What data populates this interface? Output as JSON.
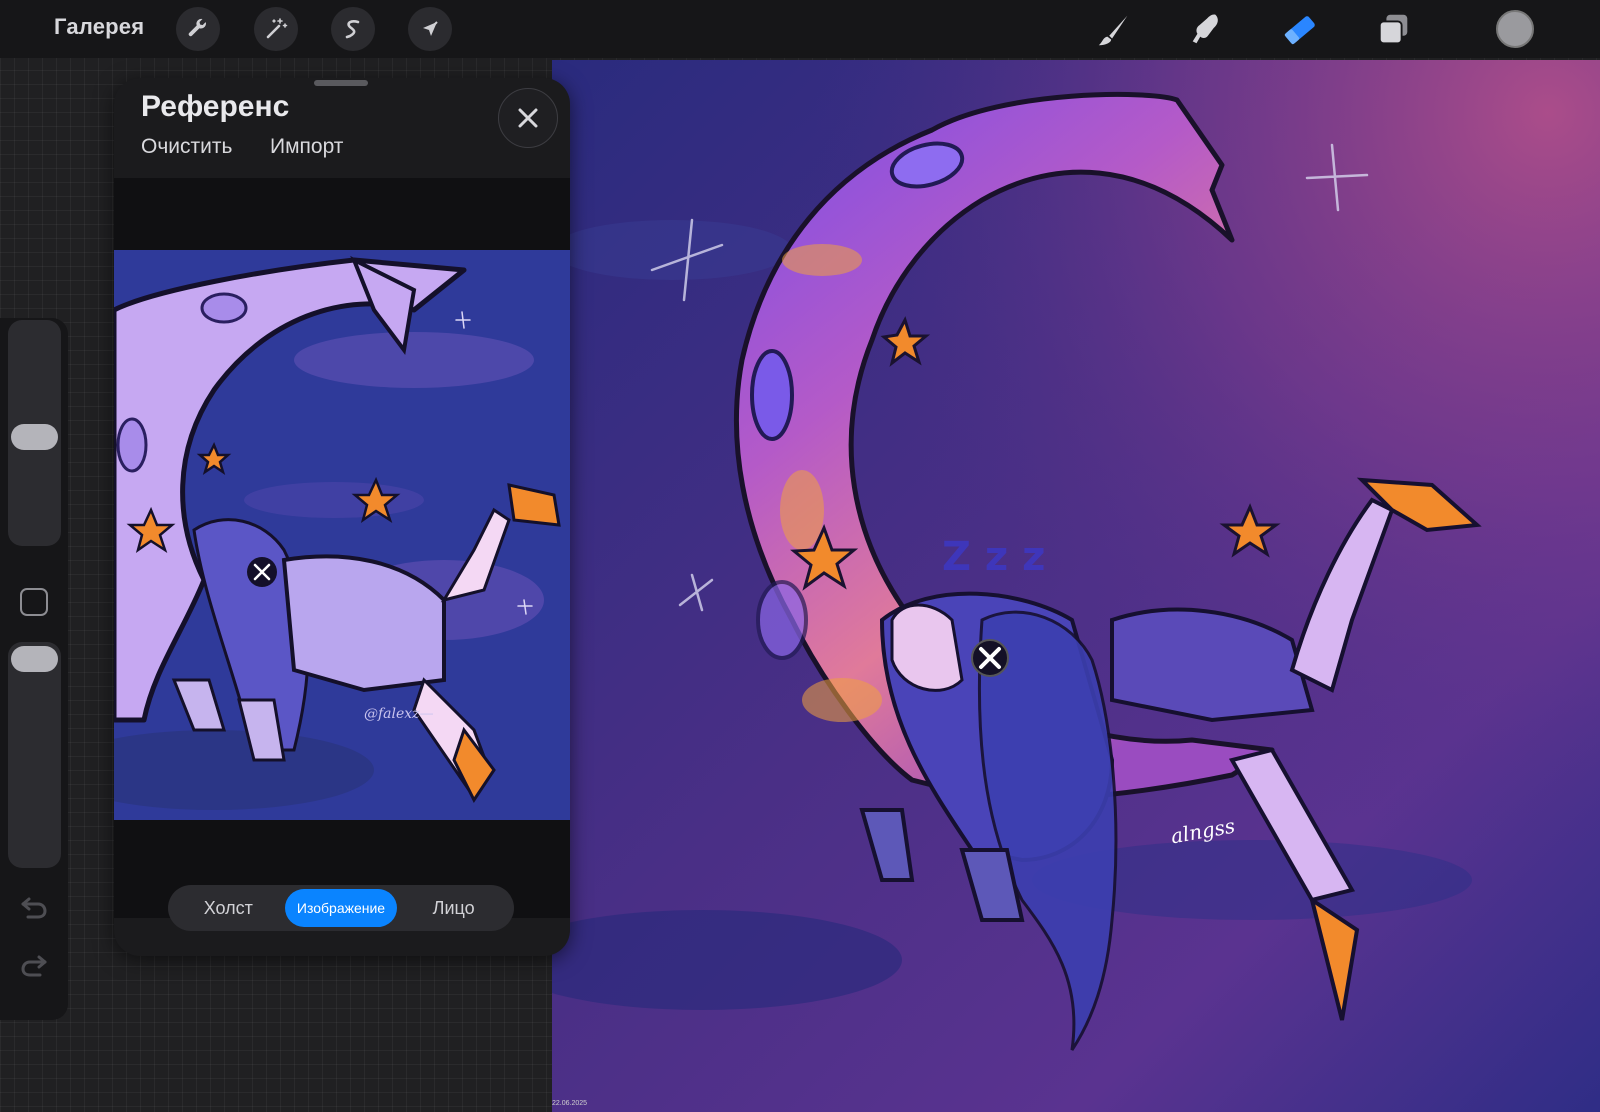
{
  "toolbar": {
    "gallery_label": "Галерея",
    "left_tools": [
      {
        "name": "actions",
        "icon": "wrench-icon"
      },
      {
        "name": "adjustments",
        "icon": "magic-wand-icon"
      },
      {
        "name": "selection",
        "icon": "selection-s-icon"
      },
      {
        "name": "transform",
        "icon": "arrow-cursor-icon"
      }
    ],
    "right_tools": [
      {
        "name": "brush",
        "icon": "brush-icon",
        "active": false
      },
      {
        "name": "smudge",
        "icon": "smudge-icon",
        "active": false
      },
      {
        "name": "eraser",
        "icon": "eraser-icon",
        "active": true
      },
      {
        "name": "layers",
        "icon": "layers-icon",
        "active": false
      }
    ],
    "current_color": "#9a9a9e",
    "active_tool_color": "#2a86ff"
  },
  "sidebar": {
    "brush_size_level": 0.48,
    "opacity_level": 0.0
  },
  "reference": {
    "title": "Референс",
    "clear_label": "Очистить",
    "import_label": "Импорт",
    "image_signature": "@falexz—",
    "tabs": [
      {
        "label": "Холст",
        "active": false
      },
      {
        "label": "Изображение",
        "active": true
      },
      {
        "label": "Лицо",
        "active": false
      }
    ]
  },
  "canvas": {
    "date_stamp": "22.06.2025",
    "signature": "alngss"
  }
}
